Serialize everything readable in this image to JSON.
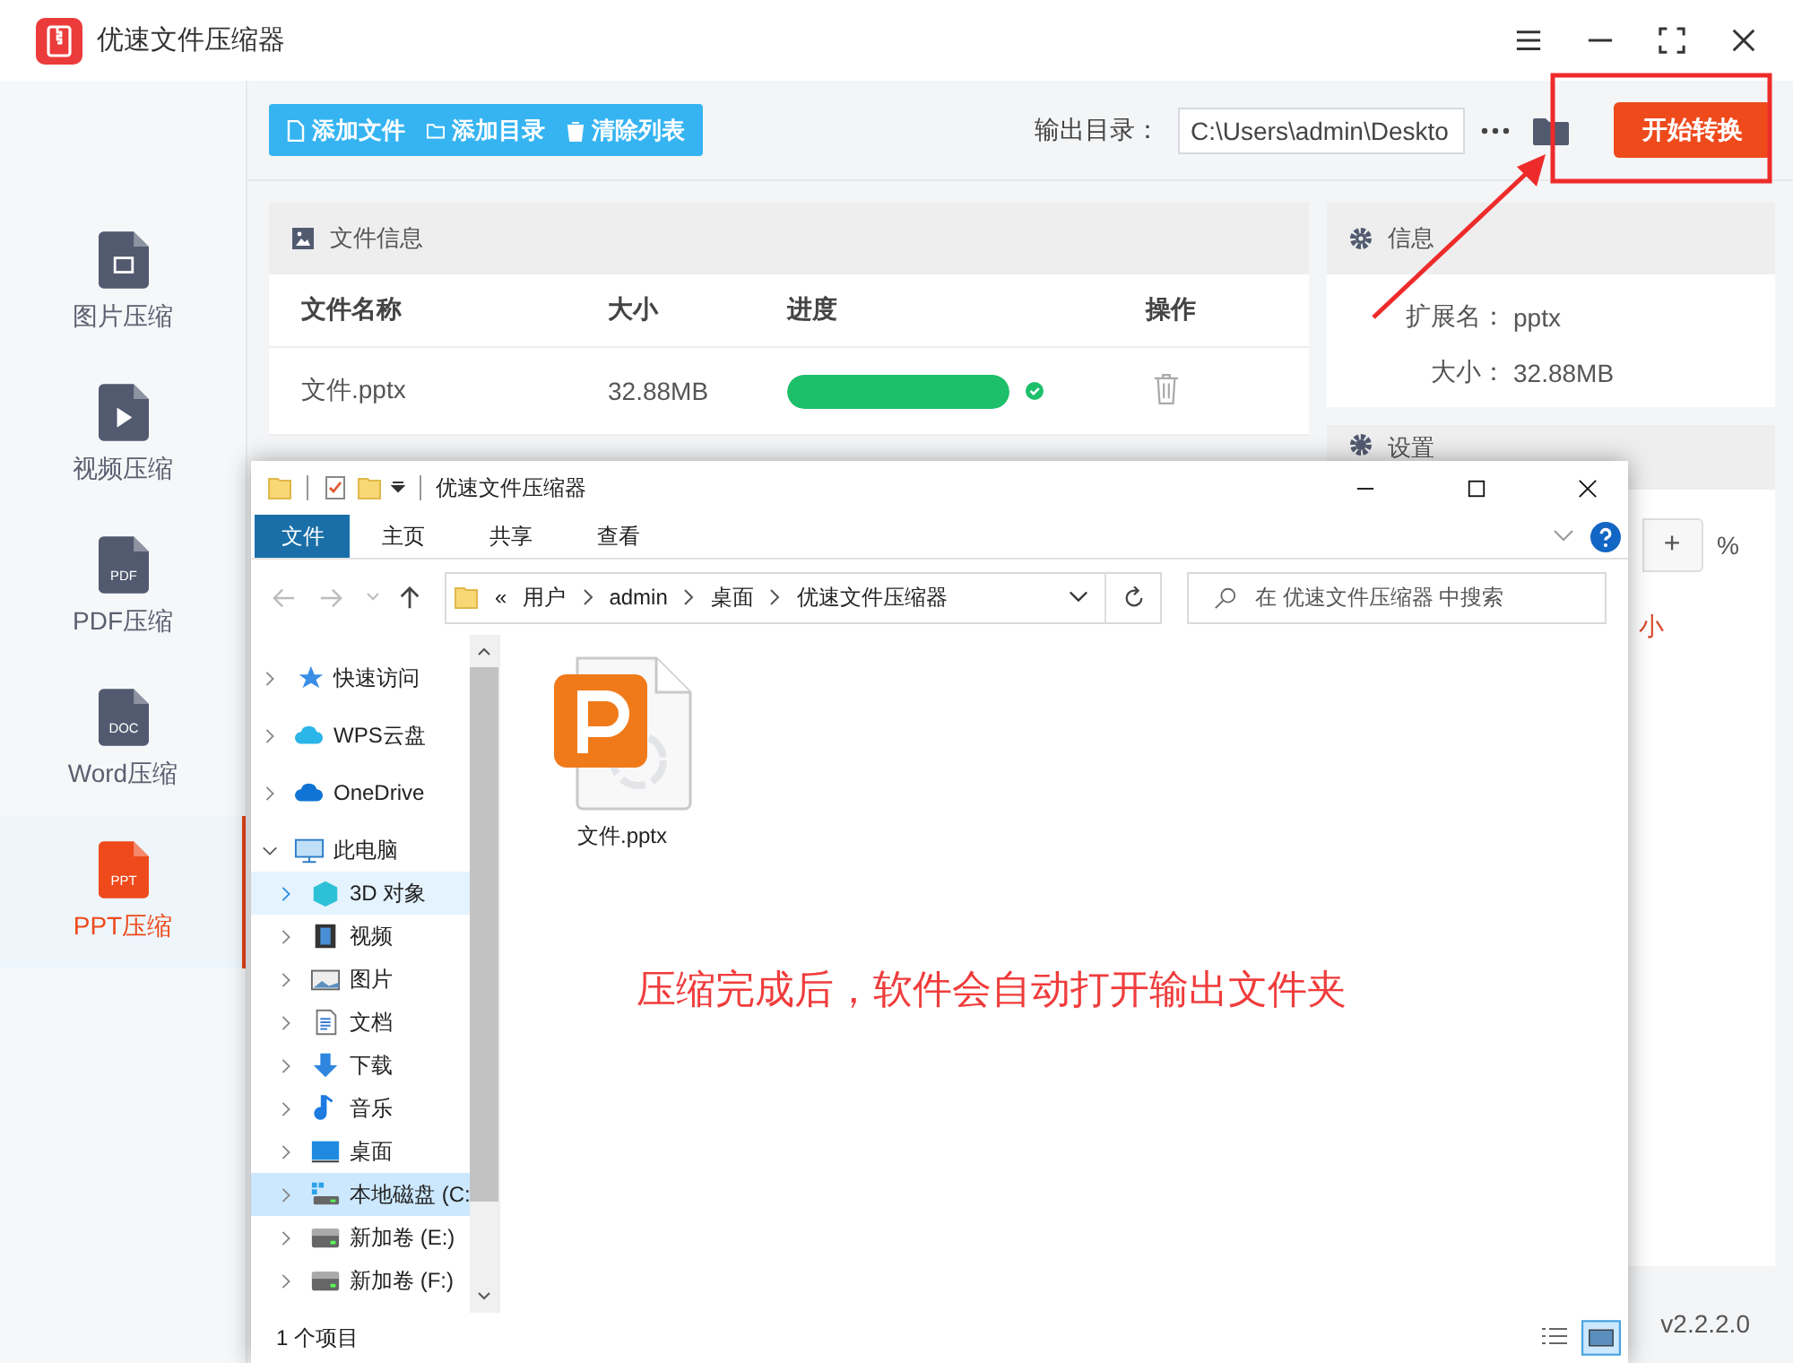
{
  "app": {
    "title": "优速文件压缩器"
  },
  "sidebar": [
    {
      "label": "图片压缩",
      "kind": "image",
      "selected": false
    },
    {
      "label": "视频压缩",
      "kind": "video",
      "selected": false
    },
    {
      "label": "PDF压缩",
      "kind": "doc",
      "icon_text": "PDF",
      "selected": false
    },
    {
      "label": "Word压缩",
      "kind": "doc",
      "icon_text": "DOC",
      "selected": false
    },
    {
      "label": "PPT压缩",
      "kind": "doc",
      "icon_text": "PPT",
      "selected": true
    }
  ],
  "toolbar": {
    "buttons": [
      {
        "label": "添加文件",
        "kind": "file"
      },
      {
        "label": "添加目录",
        "kind": "folder"
      },
      {
        "label": "清除列表",
        "kind": "trash"
      }
    ],
    "output_label": "输出目录：",
    "output_path": "C:\\Users\\admin\\Deskto",
    "start_button": "开始转换"
  },
  "file_panel": {
    "title": "文件信息",
    "columns": [
      "文件名称",
      "大小",
      "进度",
      "操作"
    ],
    "rows": [
      {
        "name": "文件.pptx",
        "size": "32.88MB",
        "level": 1,
        "done": true
      }
    ]
  },
  "info_panel": {
    "title": "信息",
    "fields": [
      {
        "label": "扩展名：",
        "value": "pptx"
      },
      {
        "label": "大小：",
        "value": "32.88MB"
      }
    ]
  },
  "settings_panel": {
    "title": "设置",
    "plus": "+",
    "unit": "%",
    "note": "小"
  },
  "version": "v2.2.2.0",
  "explorer": {
    "title": "优速文件压缩器",
    "tabs": [
      {
        "label": "文件",
        "selected": true
      },
      {
        "label": "主页",
        "selected": false
      },
      {
        "label": "共享",
        "selected": false
      },
      {
        "label": "查看",
        "selected": false
      }
    ],
    "breadcrumb_prefix": "«",
    "breadcrumb": [
      "用户",
      "admin",
      "桌面",
      "优速文件压缩器"
    ],
    "search_placeholder": "在 优速文件压缩器 中搜索",
    "nav": [
      {
        "label": "快速访问",
        "kind": "star",
        "expanded": false,
        "selected": false,
        "hovered": false
      },
      {
        "label": "WPS云盘",
        "kind": "cloud",
        "expanded": false,
        "selected": false,
        "hovered": false
      },
      {
        "label": "OneDrive",
        "kind": "onedrive",
        "expanded": false,
        "selected": false,
        "hovered": false
      },
      {
        "label": "此电脑",
        "kind": "pc",
        "expanded": true,
        "selected": false,
        "hovered": false,
        "children": [
          {
            "label": "3D 对象",
            "kind": "cube",
            "expanded": false,
            "selected": false,
            "hovered": true
          },
          {
            "label": "视频",
            "kind": "film",
            "expanded": false,
            "selected": false,
            "hovered": false
          },
          {
            "label": "图片",
            "kind": "picture",
            "expanded": false,
            "selected": false,
            "hovered": false
          },
          {
            "label": "文档",
            "kind": "document",
            "expanded": false,
            "selected": false,
            "hovered": false
          },
          {
            "label": "下载",
            "kind": "download",
            "expanded": false,
            "selected": false,
            "hovered": false
          },
          {
            "label": "音乐",
            "kind": "music",
            "expanded": false,
            "selected": false,
            "hovered": false
          },
          {
            "label": "桌面",
            "kind": "desktop",
            "expanded": false,
            "selected": false,
            "hovered": false
          },
          {
            "label": "本地磁盘 (C:",
            "kind": "system-disk",
            "expanded": false,
            "selected": true,
            "hovered": false
          },
          {
            "label": "新加卷 (E:)",
            "kind": "disk",
            "expanded": false,
            "selected": false,
            "hovered": false
          },
          {
            "label": "新加卷 (F:)",
            "kind": "disk",
            "expanded": false,
            "selected": false,
            "hovered": false
          }
        ]
      }
    ],
    "files": [
      {
        "name": "文件.pptx",
        "kind": "pptx"
      }
    ],
    "annotation": "压缩完成后，软件会自动打开输出文件夹",
    "status": "1 个项目"
  }
}
